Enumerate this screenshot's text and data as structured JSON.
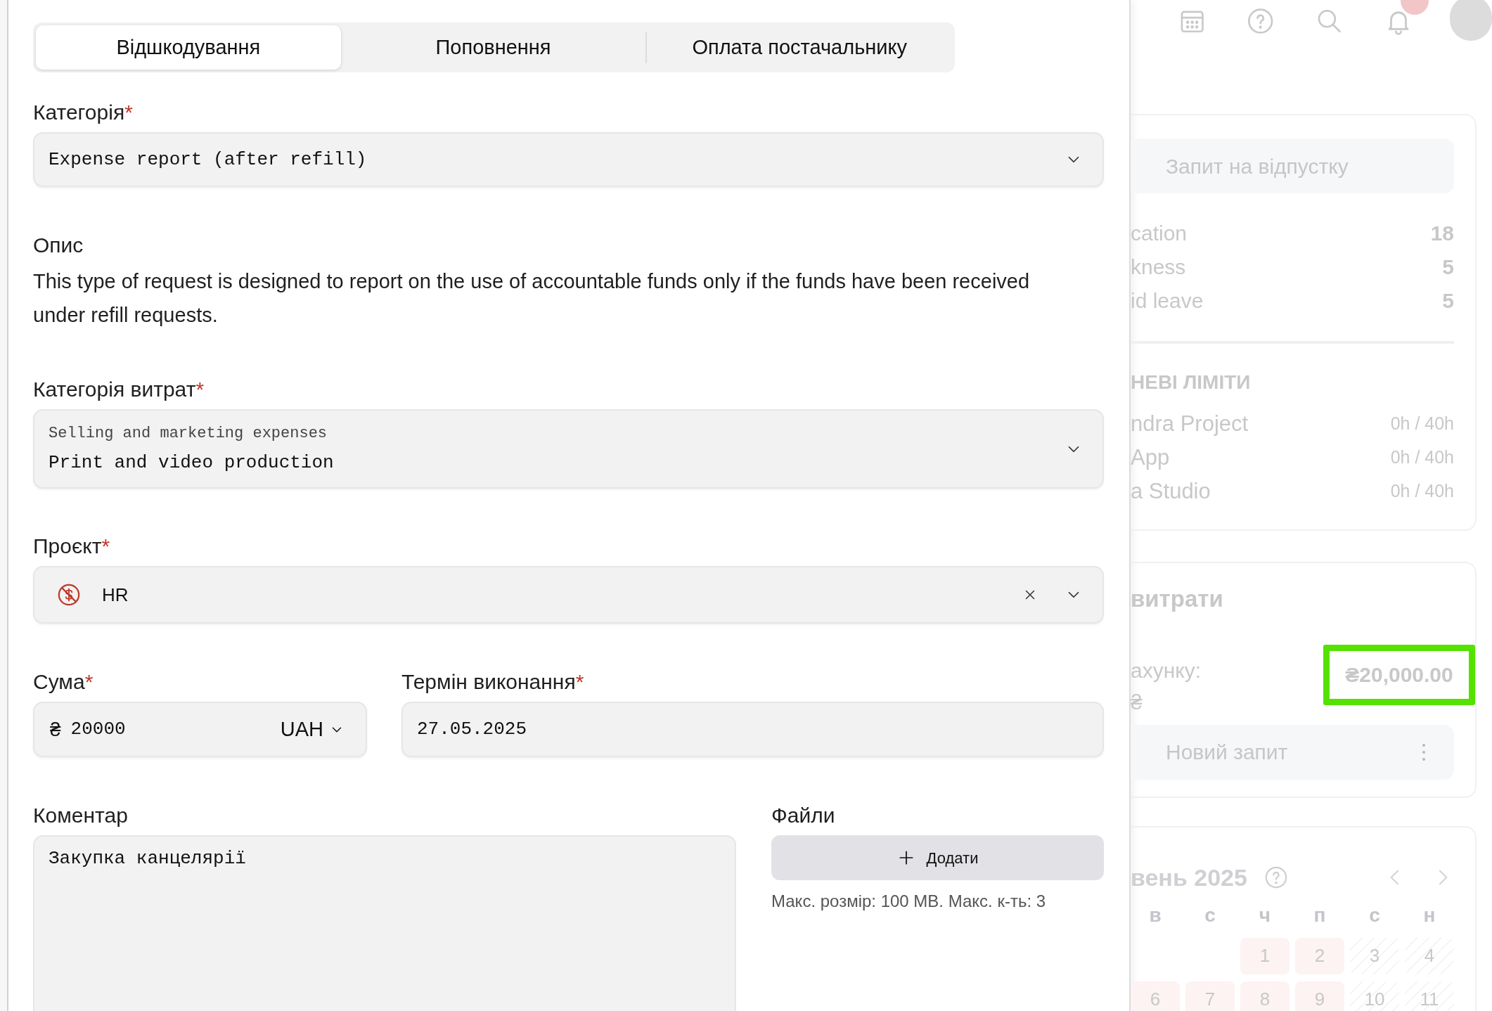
{
  "tabs": [
    {
      "label": "Відшкодування",
      "selected": true
    },
    {
      "label": "Поповнення",
      "selected": false
    },
    {
      "label": "Оплата постачальнику",
      "selected": false
    }
  ],
  "category": {
    "label": "Категорія",
    "required_mark": "*",
    "value": "Expense report (after refill)"
  },
  "description": {
    "label": "Опис",
    "text": "This type of request is designed to report on the use of accountable funds only if the funds have been received under refill requests."
  },
  "expense_category": {
    "label": "Категорія витрат",
    "required_mark": "*",
    "group": "Selling and marketing expenses",
    "value": "Print and video production"
  },
  "project": {
    "label": "Проєкт",
    "required_mark": "*",
    "value": "HR"
  },
  "amount": {
    "label": "Сума",
    "required_mark": "*",
    "symbol": "₴",
    "value": "20000",
    "currency": "UAH"
  },
  "due_date": {
    "label": "Термін виконання",
    "required_mark": "*",
    "value": "27.05.2025"
  },
  "comment": {
    "label": "Коментар",
    "value": "Закупка канцелярії"
  },
  "files": {
    "label": "Файли",
    "button": "Додати",
    "hint": "Макс. розмір: 100 MB. Макс. к-ть: 3"
  },
  "background": {
    "vacation_button": "Запит на відпустку",
    "balances": [
      {
        "label": "cation",
        "value": "18"
      },
      {
        "label": "kness",
        "value": "5"
      },
      {
        "label": "id leave",
        "value": "5"
      }
    ],
    "limits_heading": "НЕВІ ЛІМІТИ",
    "limits": [
      {
        "label": "ndra Project",
        "value": "0h / 40h"
      },
      {
        "label": "App",
        "value": "0h / 40h"
      },
      {
        "label": "a Studio",
        "value": "0h / 40h"
      }
    ],
    "expenses_title": "витрати",
    "account_label": "ахунку:",
    "currency_sign": "₴",
    "balance": "₴20,000.00",
    "balance_highlighted": true,
    "new_request_button": "Новий запит",
    "calendar": {
      "title": "вень 2025",
      "weekdays": [
        "в",
        "с",
        "ч",
        "п",
        "с",
        "н"
      ],
      "days": [
        {
          "kind": "blank"
        },
        {
          "kind": "blank"
        },
        {
          "day": "1",
          "kind": "workday"
        },
        {
          "day": "2",
          "kind": "workday"
        },
        {
          "day": "3",
          "kind": "weekend"
        },
        {
          "day": "4",
          "kind": "weekend"
        },
        {
          "day": "6",
          "kind": "workday"
        },
        {
          "day": "7",
          "kind": "workday"
        },
        {
          "day": "8",
          "kind": "workday"
        },
        {
          "day": "9",
          "kind": "workday"
        },
        {
          "day": "10",
          "kind": "weekend"
        },
        {
          "day": "11",
          "kind": "weekend"
        }
      ]
    }
  }
}
